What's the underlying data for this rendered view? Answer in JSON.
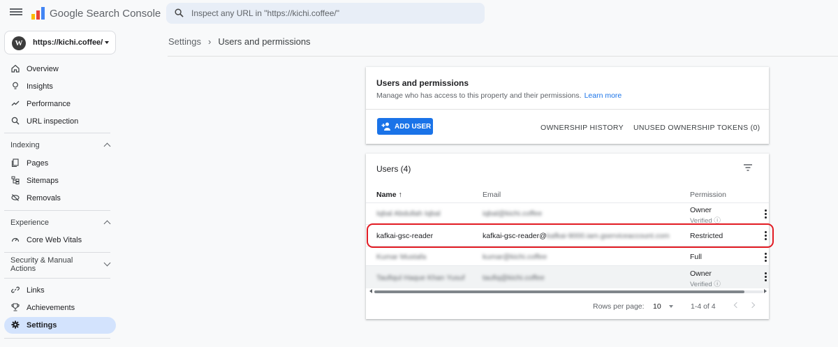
{
  "app": {
    "title": "Google Search Console",
    "search_placeholder": "Inspect any URL in \"https://kichi.coffee/\""
  },
  "property": {
    "label": "https://kichi.coffee/"
  },
  "sidebar": {
    "top_items": [
      {
        "label": "Overview",
        "icon": "home-icon"
      },
      {
        "label": "Insights",
        "icon": "lightbulb-icon"
      },
      {
        "label": "Performance",
        "icon": "trending-up-icon"
      },
      {
        "label": "URL inspection",
        "icon": "search-icon"
      }
    ],
    "sections": [
      {
        "title": "Indexing",
        "items": [
          {
            "label": "Pages",
            "icon": "pages-icon"
          },
          {
            "label": "Sitemaps",
            "icon": "sitemap-icon"
          },
          {
            "label": "Removals",
            "icon": "removals-icon"
          }
        ]
      },
      {
        "title": "Experience",
        "items": [
          {
            "label": "Core Web Vitals",
            "icon": "gauge-icon"
          }
        ]
      },
      {
        "title": "Security & Manual Actions",
        "items": []
      }
    ],
    "bottom_items": [
      {
        "label": "Links",
        "icon": "link-icon"
      },
      {
        "label": "Achievements",
        "icon": "trophy-icon"
      },
      {
        "label": "Settings",
        "icon": "gear-icon"
      }
    ]
  },
  "breadcrumb": {
    "parent": "Settings",
    "separator": "›",
    "current": "Users and permissions"
  },
  "permissions_card": {
    "title": "Users and permissions",
    "description": "Manage who has access to this property and their permissions.",
    "learn_more": "Learn more",
    "add_user": "ADD USER",
    "ownership_history": "OWNERSHIP HISTORY",
    "unused_tokens": "UNUSED OWNERSHIP TOKENS (0)"
  },
  "users_card": {
    "title": "Users (4)",
    "columns": {
      "name": "Name",
      "sort_arrow": "↑",
      "email": "Email",
      "permission": "Permission"
    },
    "rows": [
      {
        "name": "Iqbal Abdullah Iqbal",
        "email": "iqbal@kichi.coffee",
        "permission": "Owner",
        "sub": "Verified",
        "blurred": true
      },
      {
        "name": "kafkai-gsc-reader",
        "email_visible": "kafkai-gsc-reader@",
        "email_hidden": "kafkai-9000.iam.gserviceaccount.com",
        "permission": "Restricted",
        "sub": "",
        "blurred": false
      },
      {
        "name": "Kumar Mustafa",
        "email": "kumar@kichi.coffee",
        "permission": "Full",
        "sub": "",
        "blurred": true
      },
      {
        "name": "Taufiqul Haque Khan Yusuf",
        "email": "taufiq@kichi.coffee",
        "permission": "Owner",
        "sub": "Verified",
        "blurred": true
      }
    ],
    "pagination": {
      "rows_per_page_label": "Rows per page:",
      "rows_per_page": "10",
      "range": "1-4 of 4"
    }
  },
  "colors": {
    "accent": "#1a73e8",
    "active_nav": "#d3e3fd",
    "highlight": "#e21b23"
  }
}
